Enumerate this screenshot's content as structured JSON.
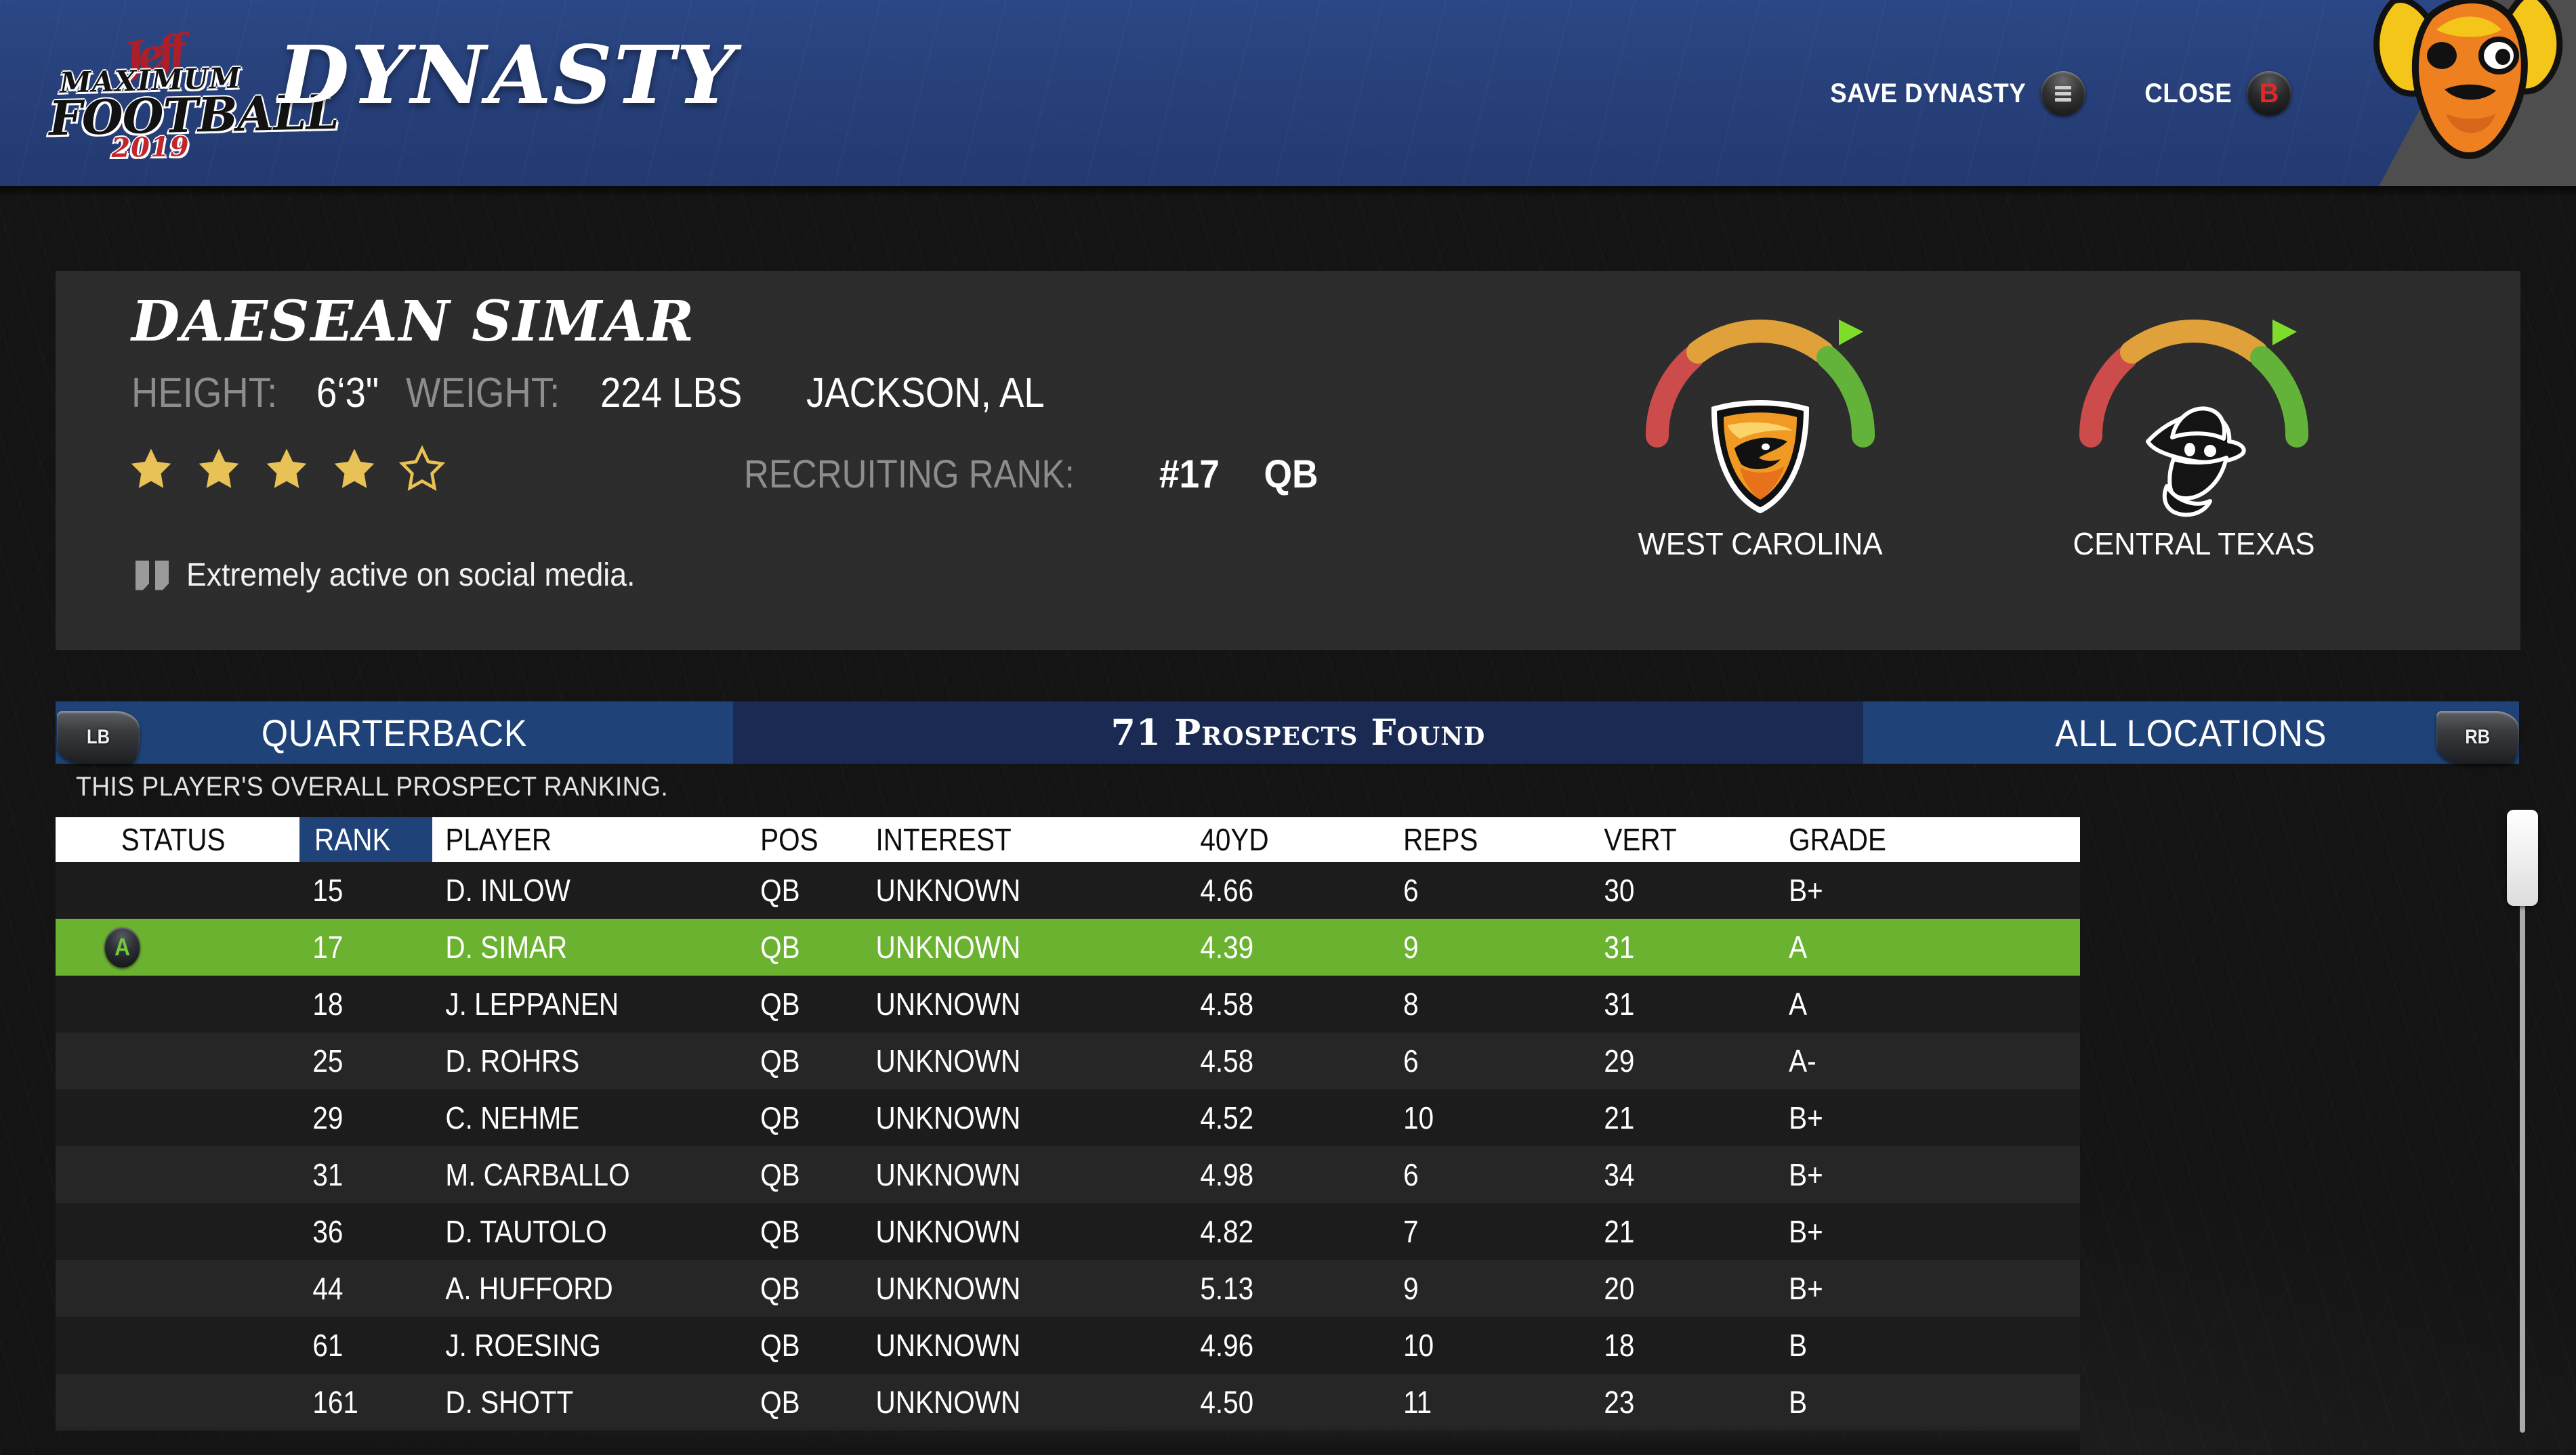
{
  "header": {
    "logo_sig": "Jeff",
    "logo_line1": "MAXIMUM",
    "logo_line2": "FOOTBALL",
    "logo_year": "2019",
    "title": "DYNASTY",
    "actions": [
      {
        "label": "SAVE DYNASTY",
        "glyph": "menu-bars",
        "icon_name": "menu-button-icon"
      },
      {
        "label": "CLOSE",
        "glyph": "B",
        "icon_name": "b-button-icon"
      }
    ]
  },
  "player": {
    "name": "DAESEAN SIMAR",
    "height_label": "HEIGHT:",
    "height_value": "6‘3\"",
    "weight_label": "WEIGHT:",
    "weight_value": "224 LBS",
    "hometown": "JACKSON, AL",
    "stars_filled": 4,
    "stars_total": 5,
    "recruiting_rank_label": "RECRUITING RANK:",
    "recruiting_rank_value": "#17",
    "position": "QB",
    "note": "Extremely active on social media.",
    "interest_gauges": [
      {
        "team": "WEST CAROLINA",
        "needle_pct": 92,
        "crest": "eagle-shield"
      },
      {
        "team": "CENTRAL TEXAS",
        "needle_pct": 92,
        "crest": "bandit-head"
      }
    ]
  },
  "nav": {
    "prev_bumper": "LB",
    "next_bumper": "RB",
    "position_filter": "QUARTERBACK",
    "prospects_found": "71 Prospects Found",
    "location_filter": "ALL LOCATIONS"
  },
  "hint": "THIS PLAYER'S OVERALL PROSPECT RANKING.",
  "table": {
    "columns": [
      "STATUS",
      "RANK",
      "PLAYER",
      "POS",
      "INTEREST",
      "40YD",
      "REPS",
      "VERT",
      "GRADE"
    ],
    "sorted_column": "RANK",
    "rows": [
      {
        "status": "",
        "rank": "15",
        "player": "D. INLOW",
        "pos": "QB",
        "interest": "UNKNOWN",
        "yd40": "4.66",
        "reps": "6",
        "vert": "30",
        "grade": "B+",
        "selected": false
      },
      {
        "status": "A",
        "rank": "17",
        "player": "D. SIMAR",
        "pos": "QB",
        "interest": "UNKNOWN",
        "yd40": "4.39",
        "reps": "9",
        "vert": "31",
        "grade": "A",
        "selected": true
      },
      {
        "status": "",
        "rank": "18",
        "player": "J. LEPPANEN",
        "pos": "QB",
        "interest": "UNKNOWN",
        "yd40": "4.58",
        "reps": "8",
        "vert": "31",
        "grade": "A",
        "selected": false
      },
      {
        "status": "",
        "rank": "25",
        "player": "D. ROHRS",
        "pos": "QB",
        "interest": "UNKNOWN",
        "yd40": "4.58",
        "reps": "6",
        "vert": "29",
        "grade": "A-",
        "selected": false
      },
      {
        "status": "",
        "rank": "29",
        "player": "C. NEHME",
        "pos": "QB",
        "interest": "UNKNOWN",
        "yd40": "4.52",
        "reps": "10",
        "vert": "21",
        "grade": "B+",
        "selected": false
      },
      {
        "status": "",
        "rank": "31",
        "player": "M. CARBALLO",
        "pos": "QB",
        "interest": "UNKNOWN",
        "yd40": "4.98",
        "reps": "6",
        "vert": "34",
        "grade": "B+",
        "selected": false
      },
      {
        "status": "",
        "rank": "36",
        "player": "D. TAUTOLO",
        "pos": "QB",
        "interest": "UNKNOWN",
        "yd40": "4.82",
        "reps": "7",
        "vert": "21",
        "grade": "B+",
        "selected": false
      },
      {
        "status": "",
        "rank": "44",
        "player": "A. HUFFORD",
        "pos": "QB",
        "interest": "UNKNOWN",
        "yd40": "5.13",
        "reps": "9",
        "vert": "20",
        "grade": "B+",
        "selected": false
      },
      {
        "status": "",
        "rank": "61",
        "player": "J. ROESING",
        "pos": "QB",
        "interest": "UNKNOWN",
        "yd40": "4.96",
        "reps": "10",
        "vert": "18",
        "grade": "B",
        "selected": false
      },
      {
        "status": "",
        "rank": "161",
        "player": "D. SHOTT",
        "pos": "QB",
        "interest": "UNKNOWN",
        "yd40": "4.50",
        "reps": "11",
        "vert": "23",
        "grade": "B",
        "selected": false
      }
    ]
  },
  "colors": {
    "brand_blue": "#25407c",
    "nav_blue": "#1f4379",
    "nav_blue_dark": "#1a2a53",
    "selected_green": "#6ab22f",
    "star_gold": "#e8c257",
    "gauge_red": "#cc4c4c",
    "gauge_yellow": "#e0a13a",
    "gauge_green": "#63b33b",
    "needle_green": "#7ddd2a",
    "close_red": "#e02828"
  }
}
